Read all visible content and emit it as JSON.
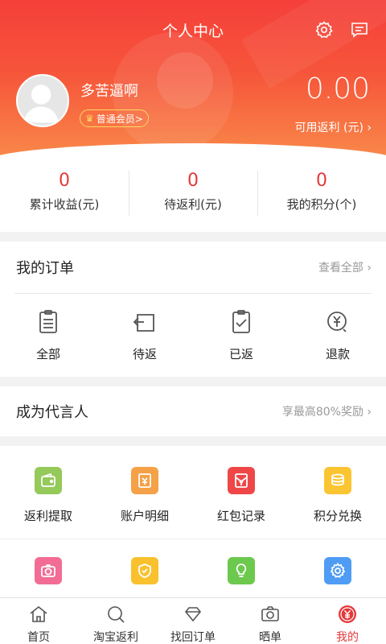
{
  "header": {
    "title": "个人中心",
    "username": "多苦逼啊",
    "member_badge": "普通会员>",
    "balance": "0.00",
    "balance_label": "可用返利 (元) ›"
  },
  "stats": [
    {
      "value": "0",
      "label": "累计收益(元)"
    },
    {
      "value": "0",
      "label": "待返利(元)"
    },
    {
      "value": "0",
      "label": "我的积分(个)"
    }
  ],
  "orders": {
    "title": "我的订单",
    "more": "查看全部 ›",
    "items": [
      "全部",
      "待返",
      "已返",
      "退款"
    ]
  },
  "promo": {
    "title": "成为代言人",
    "more": "享最高80%奖励 ›"
  },
  "features": {
    "row1": [
      {
        "label": "返利提取",
        "icon": "wallet-icon",
        "color": "#95c95a"
      },
      {
        "label": "账户明细",
        "icon": "ledger-icon",
        "color": "#f4a147"
      },
      {
        "label": "红包记录",
        "icon": "red-envelope-icon",
        "color": "#ef4747"
      },
      {
        "label": "积分兑换",
        "icon": "coins-icon",
        "color": "#fbc531"
      }
    ],
    "row2": [
      {
        "icon": "camera-icon",
        "color": "#f26c96"
      },
      {
        "icon": "shield-icon",
        "color": "#f8c12d"
      },
      {
        "icon": "bulb-icon",
        "color": "#6cc94d"
      },
      {
        "icon": "gear-icon",
        "color": "#4f9cf5"
      }
    ]
  },
  "tabbar": [
    {
      "label": "首页",
      "icon": "home-icon"
    },
    {
      "label": "淘宝返利",
      "icon": "search-icon"
    },
    {
      "label": "找回订单",
      "icon": "diamond-icon"
    },
    {
      "label": "晒单",
      "icon": "camera-icon"
    },
    {
      "label": "我的",
      "icon": "yen-coin-icon",
      "active": true
    }
  ],
  "colors": {
    "accent": "#e4393c",
    "header_top": "#f53f3a",
    "header_bottom": "#f98a4a",
    "badge_gold": "#fbd95f"
  }
}
